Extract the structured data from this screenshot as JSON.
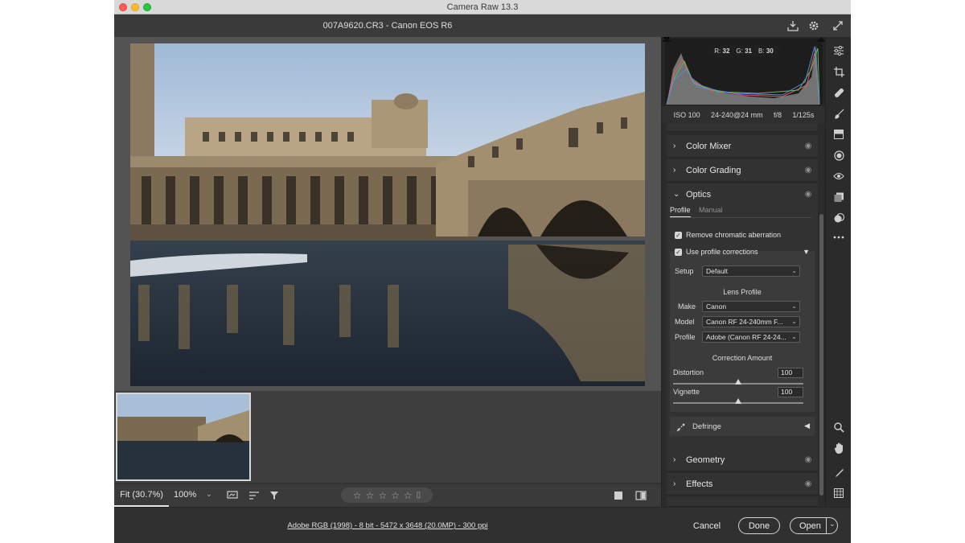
{
  "window": {
    "title": "Camera Raw 13.3"
  },
  "file": {
    "name": "007A9620.CR3  -  Canon EOS R6"
  },
  "histogram": {
    "r_label": "R:",
    "r_value": "32",
    "g_label": "G:",
    "g_value": "31",
    "b_label": "B:",
    "b_value": "30"
  },
  "exif": {
    "iso": "ISO 100",
    "lens": "24-240@24 mm",
    "aperture": "f/8",
    "shutter": "1/125s"
  },
  "sections": {
    "color_mixer": "Color Mixer",
    "color_grading": "Color Grading",
    "optics": "Optics",
    "geometry": "Geometry",
    "effects": "Effects"
  },
  "optics": {
    "tab_profile": "Profile",
    "tab_manual": "Manual",
    "remove_ca": "Remove chromatic aberration",
    "use_profile": "Use profile corrections",
    "setup_label": "Setup",
    "setup_value": "Default",
    "lens_profile_heading": "Lens Profile",
    "make_label": "Make",
    "make_value": "Canon",
    "model_label": "Model",
    "model_value": "Canon RF 24-240mm F...",
    "profile_label": "Profile",
    "profile_value": "Adobe (Canon RF 24-24...",
    "correction_heading": "Correction Amount",
    "distortion_label": "Distortion",
    "distortion_value": "100",
    "vignette_label": "Vignette",
    "vignette_value": "100",
    "defringe": "Defringe"
  },
  "toolbar": {
    "zoom_fit": "Fit (30.7%)",
    "zoom_pct": "100%"
  },
  "status": {
    "meta": "Adobe RGB (1998) - 8 bit - 5472 x 3648 (20.0MP) - 300 ppi",
    "cancel": "Cancel",
    "done": "Done",
    "open": "Open"
  },
  "colors": {
    "accent": "#3a3a3a",
    "panel": "#2b2b2b",
    "preview_bg": "#535353"
  }
}
